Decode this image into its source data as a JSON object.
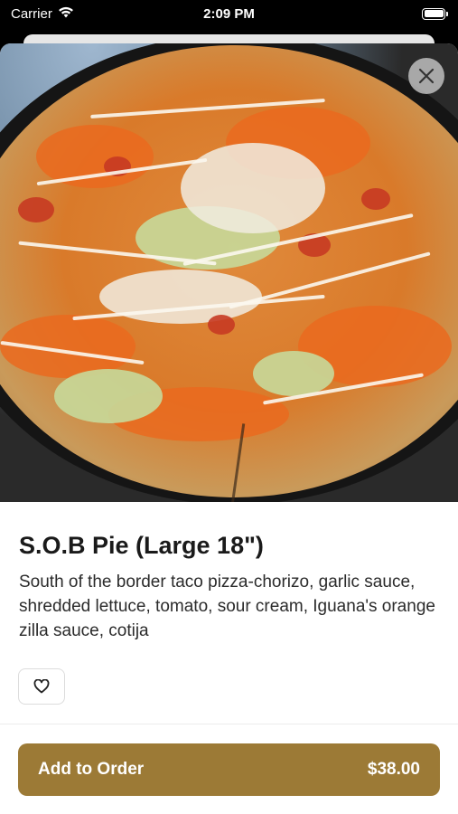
{
  "status_bar": {
    "carrier": "Carrier",
    "time": "2:09 PM"
  },
  "item": {
    "name": "S.O.B Pie (Large 18\")",
    "description": "South of the border taco pizza-chorizo, garlic sauce, shredded lettuce, tomato, sour cream, Iguana's orange zilla sauce, cotija",
    "image_icon": "pizza-photo"
  },
  "actions": {
    "close_icon": "close-icon",
    "favorite_icon": "heart-icon",
    "add_label": "Add to Order",
    "price": "$38.00"
  },
  "colors": {
    "accent": "#9c7a36",
    "background": "#ffffff",
    "text": "#1a1a1a"
  }
}
